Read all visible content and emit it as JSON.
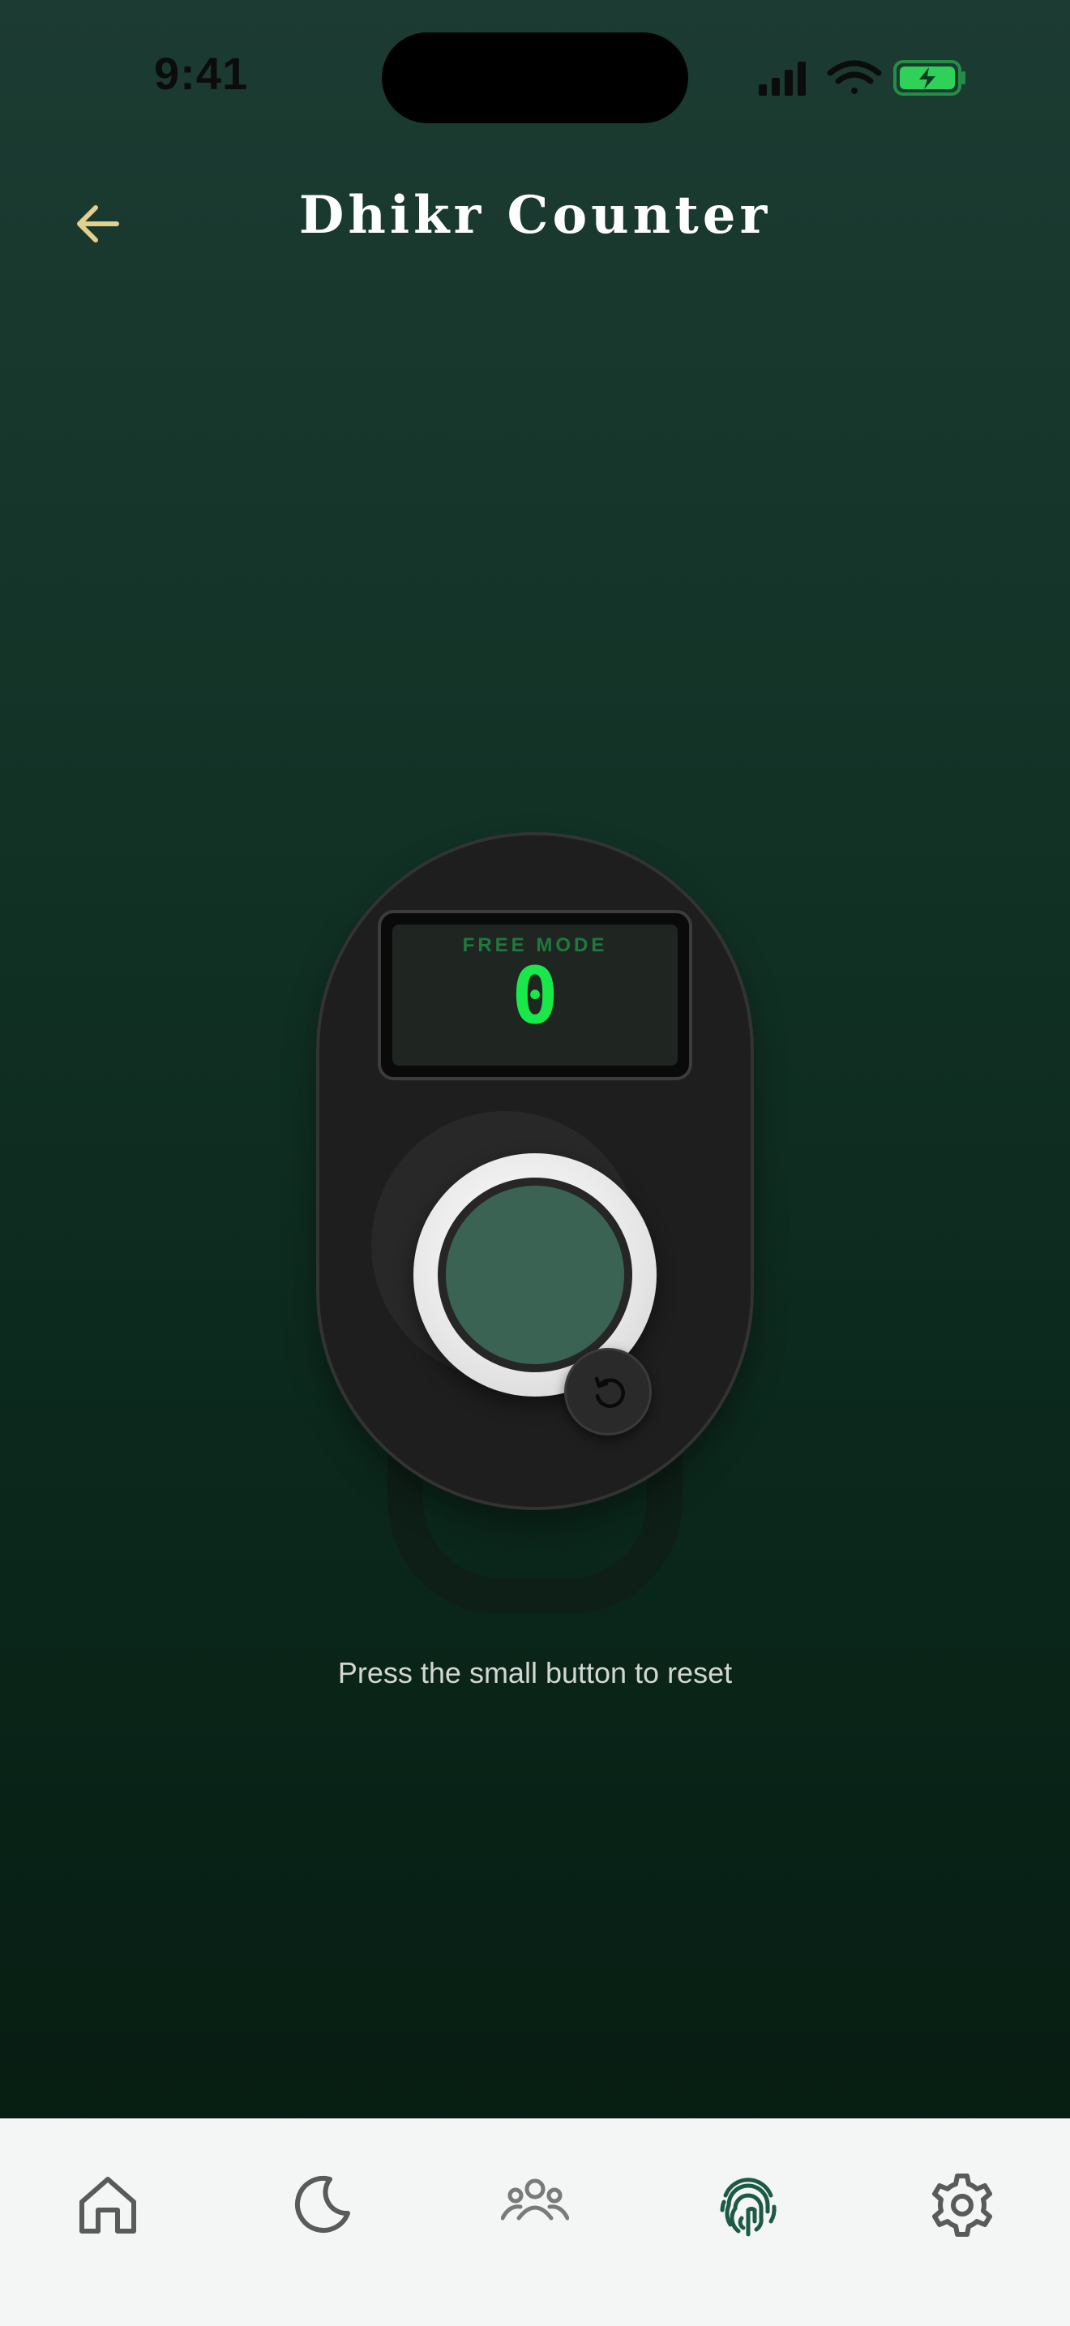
{
  "status_bar": {
    "time": "9:41"
  },
  "header": {
    "title": "Dhikr Counter",
    "back_icon": "arrow-left-icon"
  },
  "counter": {
    "mode_label": "FREE MODE",
    "count": "0",
    "reset_icon": "rotate-ccw-icon"
  },
  "hint": "Press the small button to reset",
  "tabbar": {
    "items": [
      {
        "icon": "home-icon",
        "active": false
      },
      {
        "icon": "moon-icon",
        "active": false
      },
      {
        "icon": "users-icon",
        "active": false
      },
      {
        "icon": "fingerprint-icon",
        "active": true
      },
      {
        "icon": "gear-icon",
        "active": false
      }
    ]
  },
  "colors": {
    "accent": "#1d5a45",
    "back_arrow": "#e3cf8e",
    "display_digits": "#19e84a",
    "mode_label": "#1e7a3a",
    "tap_button": "#3a6354",
    "battery": "#2fd158"
  }
}
